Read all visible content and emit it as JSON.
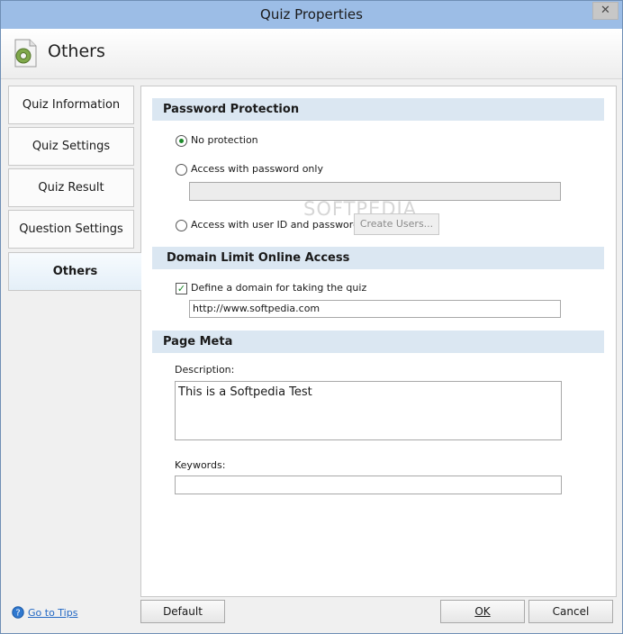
{
  "window": {
    "title": "Quiz Properties",
    "close_glyph": "✕"
  },
  "header": {
    "title": "Others",
    "icon": "gear-document-icon"
  },
  "nav": {
    "items": [
      {
        "label": "Quiz Information"
      },
      {
        "label": "Quiz Settings"
      },
      {
        "label": "Quiz Result"
      },
      {
        "label": "Question Settings"
      },
      {
        "label": "Others"
      }
    ]
  },
  "password": {
    "heading": "Password Protection",
    "options": [
      {
        "label": "No protection",
        "selected": true
      },
      {
        "label": "Access with password only",
        "selected": false
      },
      {
        "label": "Access with user ID and password",
        "selected": false
      }
    ],
    "password_value": "",
    "create_users_label": "Create Users..."
  },
  "domain": {
    "heading": "Domain Limit Online Access",
    "checkbox_label": "Define a domain for taking the quiz",
    "checked": true,
    "url_value": "http://www.softpedia.com"
  },
  "meta": {
    "heading": "Page Meta",
    "description_label": "Description:",
    "description_value": "This is a Softpedia Test",
    "keywords_label": "Keywords:",
    "keywords_value": ""
  },
  "watermark": "SOFTPEDIA",
  "footer": {
    "tips_label": "Go to Tips",
    "default_label": "Default",
    "ok_label": "OK",
    "cancel_label": "Cancel"
  },
  "colors": {
    "titlebar": "#9cbde6",
    "section_bg": "#dbe7f2",
    "link": "#2268c4",
    "radio_dot": "#1d8a2a"
  }
}
